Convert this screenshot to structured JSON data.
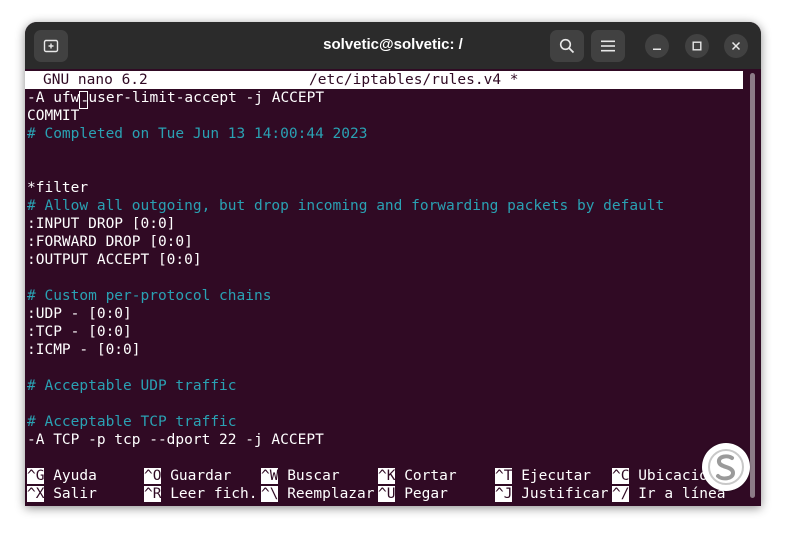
{
  "window": {
    "title": "solvetic@solvetic: /",
    "new_tab_icon": "new-tab-icon",
    "search_icon": "search-icon",
    "menu_icon": "hamburger-menu-icon"
  },
  "nano": {
    "version": "GNU nano 6.2",
    "filename": "/etc/iptables/rules.v4 *",
    "lines": [
      {
        "pre": "-A ufw",
        "cursor": "-",
        "post": "user-limit-accept -j ACCEPT"
      },
      {
        "text": "COMMIT"
      },
      {
        "text": "# Completed on Tue Jun 13 14:00:44 2023"
      },
      {
        "text": "*filter"
      },
      {
        "text": "# Allow all outgoing, but drop incoming and forwarding packets by default"
      },
      {
        "text": ":INPUT DROP [0:0]"
      },
      {
        "text": ":FORWARD DROP [0:0]"
      },
      {
        "text": ":OUTPUT ACCEPT [0:0]"
      },
      {
        "text": "# Custom per-protocol chains"
      },
      {
        "text": ":UDP - [0:0]"
      },
      {
        "text": ":TCP - [0:0]"
      },
      {
        "text": ":ICMP - [0:0]"
      },
      {
        "text": "# Acceptable UDP traffic"
      },
      {
        "text": "# Acceptable TCP traffic"
      },
      {
        "text": "-A TCP -p tcp --dport 22 -j ACCEPT"
      }
    ],
    "shortcuts_row1": [
      {
        "key": "^G",
        "label": "Ayuda"
      },
      {
        "key": "^O",
        "label": "Guardar"
      },
      {
        "key": "^W",
        "label": "Buscar"
      },
      {
        "key": "^K",
        "label": "Cortar"
      },
      {
        "key": "^T",
        "label": "Ejecutar"
      },
      {
        "key": "^C",
        "label": "Ubicación"
      }
    ],
    "shortcuts_row2": [
      {
        "key": "^X",
        "label": "Salir"
      },
      {
        "key": "^R",
        "label": "Leer fich."
      },
      {
        "key": "^\\",
        "label": "Reemplazar"
      },
      {
        "key": "^U",
        "label": "Pegar"
      },
      {
        "key": "^J",
        "label": "Justificar"
      },
      {
        "key": "^/",
        "label": "Ir a línea"
      }
    ]
  },
  "colors": {
    "terminal_bg": "#300a24",
    "comment": "#2aa1b3",
    "titlebar": "#2b2b2b"
  }
}
